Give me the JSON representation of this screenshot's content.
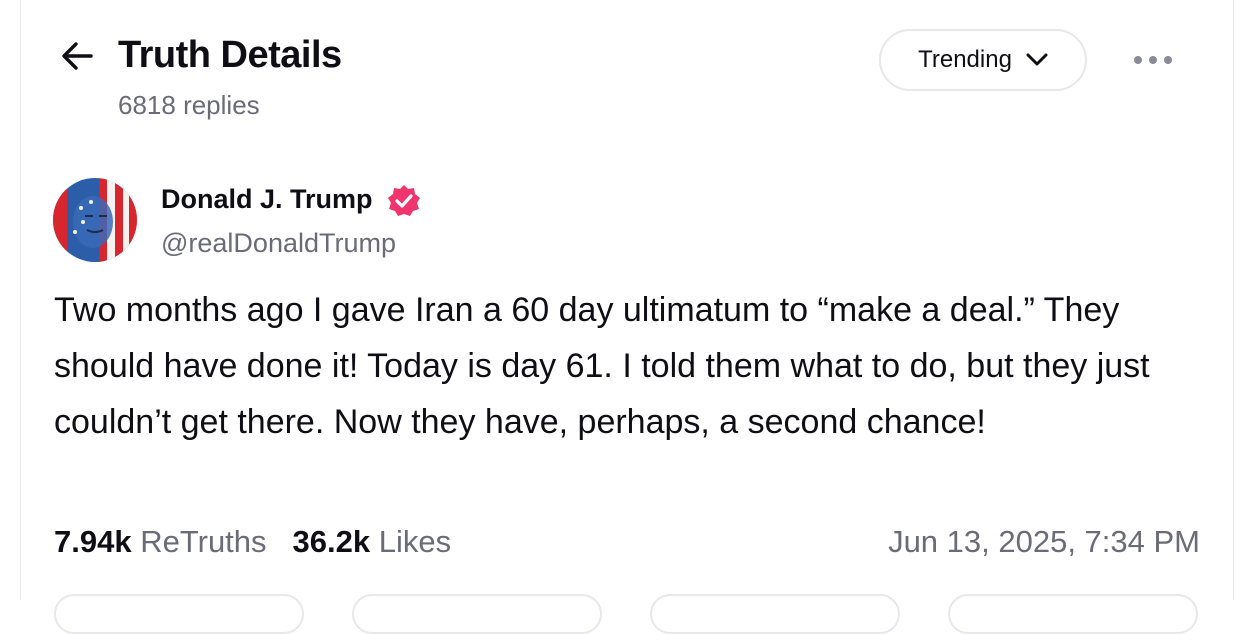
{
  "header": {
    "title": "Truth Details",
    "replies_count": "6818 replies",
    "sort_label": "Trending",
    "back_icon": "arrow-left-icon",
    "more_icon": "more-horizontal-icon"
  },
  "post": {
    "author_name": "Donald J. Trump",
    "author_handle": "@realDonaldTrump",
    "verified": true,
    "verified_color": "#f0346e",
    "text": "Two months ago I gave Iran a 60 day ultimatum to “make a deal.” They should have done it! Today is day 61. I told them what to do, but they just couldn’t get there. Now they have, perhaps, a second chance!",
    "retruths_count": "7.94k",
    "retruths_label": "ReTruths",
    "likes_count": "36.2k",
    "likes_label": "Likes",
    "timestamp": "Jun 13, 2025, 7:34 PM"
  },
  "colors": {
    "text_primary": "#0e0e14",
    "text_secondary": "#6b6b78",
    "border": "#e7e7ec"
  }
}
